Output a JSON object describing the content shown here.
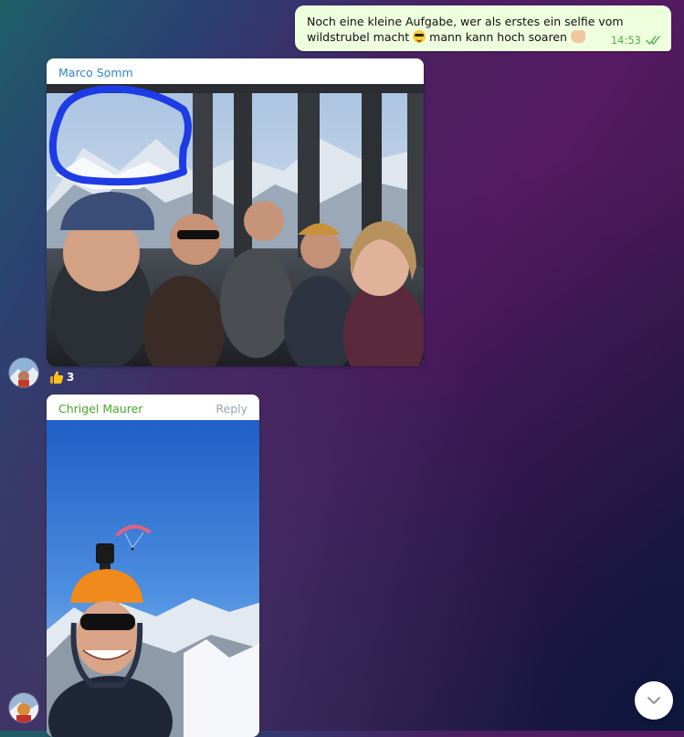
{
  "outgoing_message": {
    "text_part1": "Noch eine kleine Aufgabe, wer als erstes ein selfie vom wildstrubel macht",
    "text_part2": "mann kann hoch soaren",
    "emoji_1": "smiling-face-with-sunglasses-icon",
    "emoji_2": "thumbs-up-light-skin-icon",
    "time": "14:53",
    "status_icon": "double-check-icon"
  },
  "messages": [
    {
      "sender": "Marco Somm",
      "sender_color": "#2f86c5",
      "photo_description_icon": "group-selfie-gondola-photo",
      "reaction": {
        "icon": "thumbs-up-icon",
        "count": "3"
      }
    },
    {
      "sender": "Chrigel Maurer",
      "sender_color": "#46a629",
      "reply_label": "Reply",
      "photo_description_icon": "helmet-selfie-mountain-photo"
    }
  ],
  "scroll_down": {
    "icon": "chevron-down-icon"
  }
}
